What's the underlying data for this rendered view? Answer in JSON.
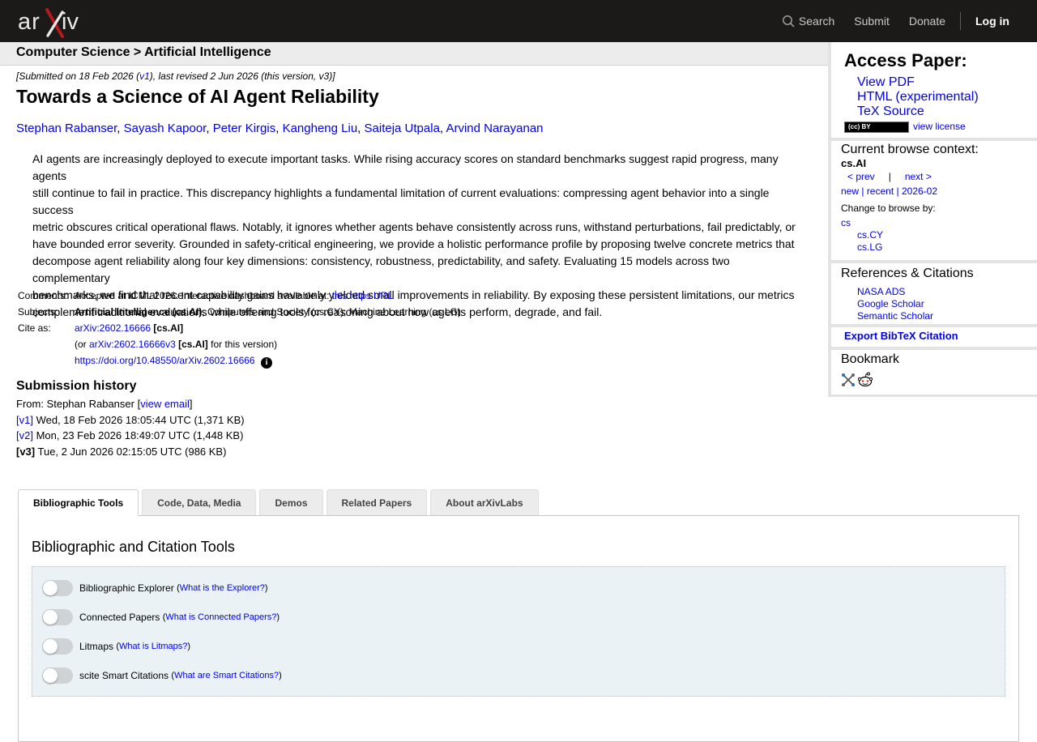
{
  "header": {
    "logo_text": "arXiv",
    "search_label": "Search",
    "submit_label": "Submit",
    "donate_label": "Donate",
    "login_label": "Log in"
  },
  "breadcrumb": "Computer Science > Artificial Intelligence",
  "paper": {
    "dateline_pre": "[Submitted on 18 Feb 2026 (",
    "dateline_v1": "v1",
    "dateline_post": "), last revised 2 Jun 2026 (this version, v3)]",
    "title": "Towards a Science of AI Agent Reliability",
    "authors": [
      "Stephan Rabanser",
      "Sayash Kapoor",
      "Peter Kirgis",
      "Kangheng Liu",
      "Saiteja Utpala",
      "Arvind Narayanan"
    ],
    "abstract_lines": [
      "AI agents are increasingly deployed to execute important tasks. While rising accuracy scores on standard benchmarks suggest rapid progress, many agents",
      "still continue to fail in practice. This discrepancy highlights a fundamental limitation of current evaluations: compressing agent behavior into a single success",
      "metric obscures critical operational flaws. Notably, it ignores whether agents behave consistently across runs, withstand perturbations, fail predictably, or",
      "have bounded error severity. Grounded in safety-critical engineering, we provide a holistic performance profile by proposing twelve concrete metrics that",
      "decompose agent reliability along four key dimensions: consistency, robustness, predictability, and safety. Evaluating 15 models across two complementary",
      "benchmarks, we find that recent capability gains have only yielded small improvements in reliability. By exposing these persistent limitations, our metrics",
      "complement traditional evaluations while offering tools for reasoning about how agents perform, degrade, and fail."
    ]
  },
  "metadata": {
    "comments_label": "Comments:",
    "comments_text": "Accepted at ICML 2026. Interactive dashboard available at: ",
    "comments_link": "this https URL",
    "subjects_label": "Subjects:",
    "subjects_primary": "Artificial Intelligence (cs.AI)",
    "subjects_rest": "; Computers and Society (cs.CY); Machine Learning (cs.LG)",
    "cite_label": "Cite as:",
    "cite_id": "arXiv:2602.16666",
    "cite_cat": "[cs.AI]",
    "cite_or": "(or ",
    "cite_v3": "arXiv:2602.16666v3",
    "cite_v3_cat": "[cs.AI]",
    "cite_v3_post": " for this version)",
    "doi": "https://doi.org/10.48550/arXiv.2602.16666",
    "info_icon": "i"
  },
  "history": {
    "heading": "Submission history",
    "from_pre": "From: Stephan Rabanser [",
    "from_link": "view email",
    "from_post": "]",
    "versions": [
      {
        "tag": "[v1]",
        "text": " Wed, 18 Feb 2026 18:05:44 UTC (1,371 KB)"
      },
      {
        "tag": "[v2]",
        "text": " Mon, 23 Feb 2026 18:49:07 UTC (1,448 KB)"
      },
      {
        "tag": "[v3]",
        "text": " Tue, 2 Jun 2026 02:15:05 UTC (986 KB)"
      }
    ]
  },
  "tabs": [
    "Bibliographic Tools",
    "Code, Data, Media",
    "Demos",
    "Related Papers",
    "About arXivLabs"
  ],
  "tools": {
    "heading": "Bibliographic and Citation Tools",
    "items": [
      {
        "label": "Bibliographic Explorer",
        "help": "What is the Explorer?"
      },
      {
        "label": "Connected Papers",
        "help": "What is Connected Papers?"
      },
      {
        "label": "Litmaps",
        "help": "What is Litmaps?"
      },
      {
        "label": "scite Smart Citations",
        "help": "What are Smart Citations?"
      }
    ]
  },
  "sidebar": {
    "access_heading": "Access Paper:",
    "view_pdf": "View PDF",
    "html": "HTML (experimental)",
    "tex": "TeX Source",
    "cc_badge": "(cc) BY",
    "view_license": "view license",
    "browse_heading": "Current browse context:",
    "browse_context": "cs.AI",
    "prev": "< prev",
    "bar": "|",
    "next": "next >",
    "new": "new",
    "recent": "recent",
    "month": "2026-02",
    "pipe": " | ",
    "change_label": "Change to browse by:",
    "browse_cs": "cs",
    "browse_cy": "cs.CY",
    "browse_lg": "cs.LG",
    "refs_heading": "References & Citations",
    "refs": [
      "NASA ADS",
      "Google Scholar",
      "Semantic Scholar"
    ],
    "export": "Export BibTeX Citation",
    "bookmark_heading": "Bookmark"
  },
  "colors": {
    "topbar": "#1b1a19",
    "logo_x": "#b31b1b",
    "link": "#0000ee",
    "toolbox_bg": "#eaf2f6"
  }
}
